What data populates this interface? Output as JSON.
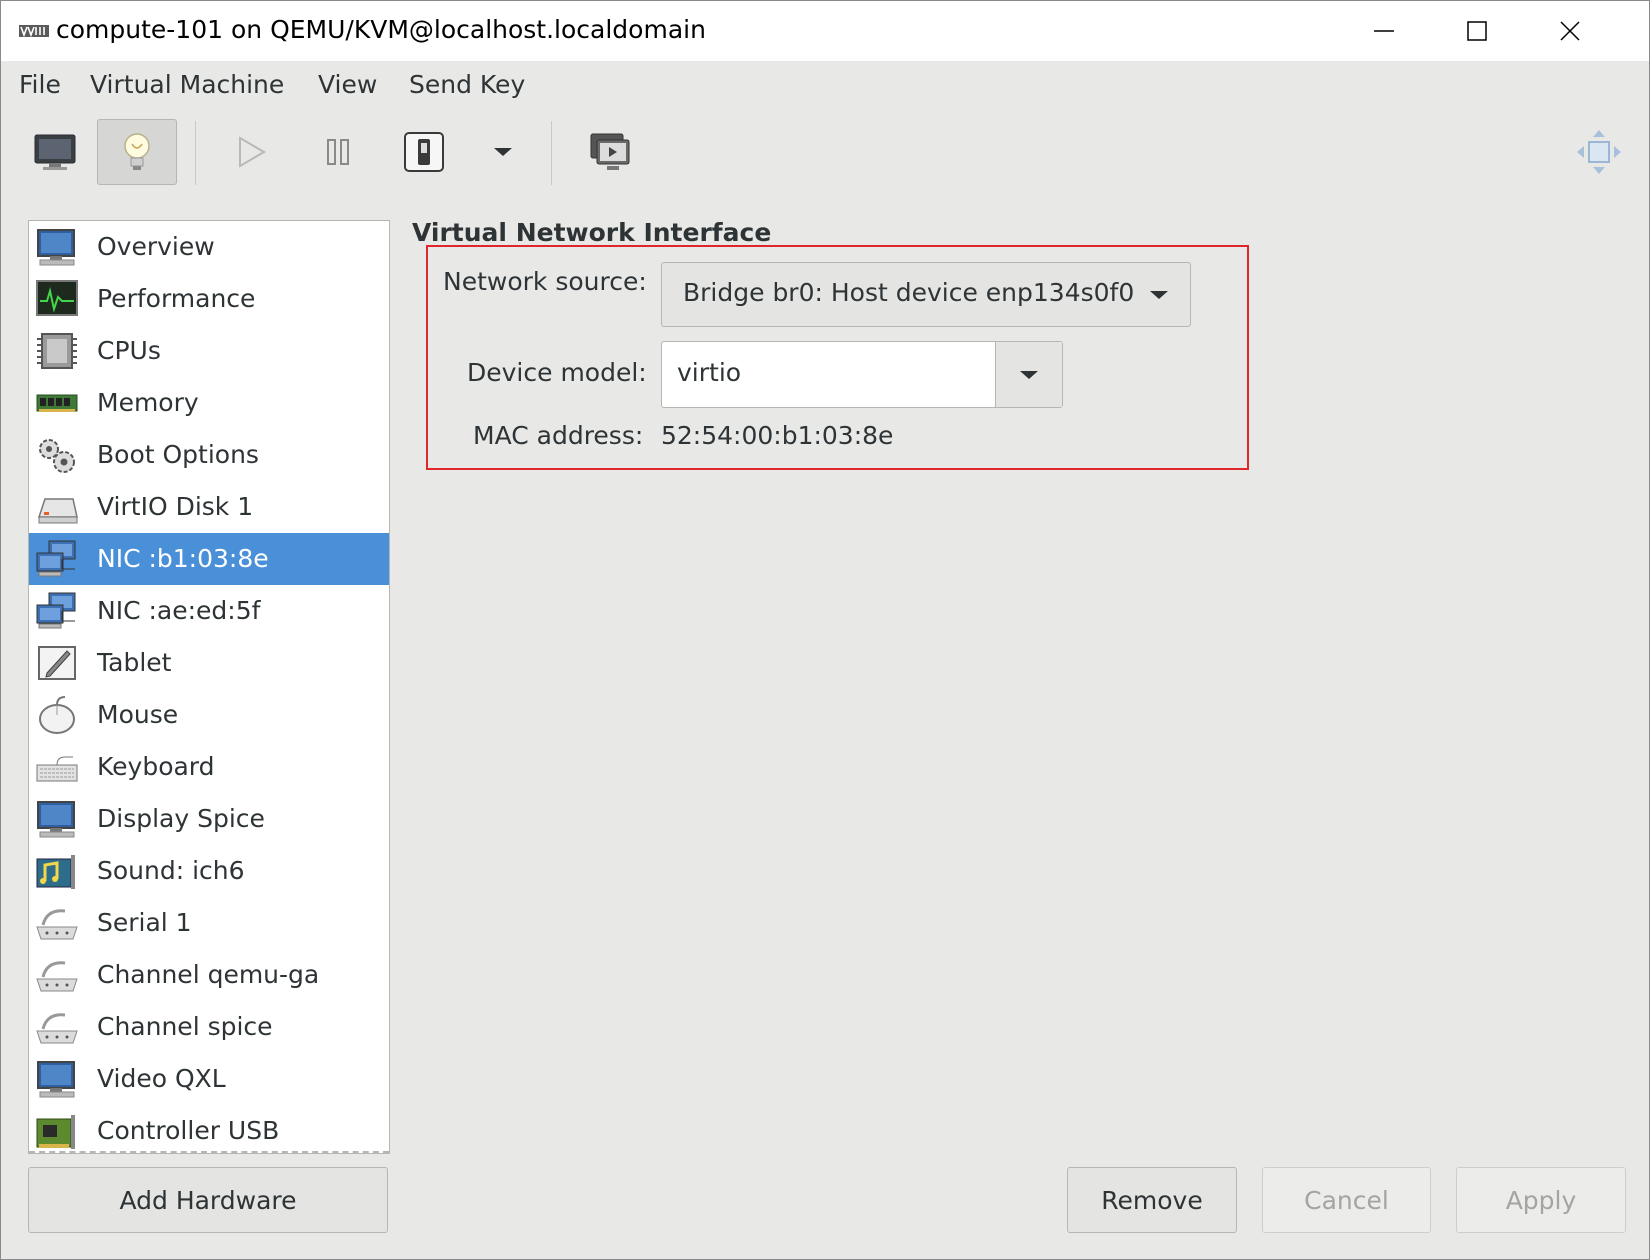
{
  "window": {
    "title": "compute-101 on QEMU/KVM@localhost.localdomain"
  },
  "menubar": {
    "items": [
      "File",
      "Virtual Machine",
      "View",
      "Send Key"
    ]
  },
  "toolbar": {
    "buttons": [
      {
        "icon": "console-monitor-icon",
        "pressed": false
      },
      {
        "icon": "lightbulb-details-icon",
        "pressed": true
      },
      {
        "icon": "play-icon",
        "pressed": false
      },
      {
        "icon": "pause-icon",
        "pressed": false
      },
      {
        "icon": "power-switch-icon",
        "pressed": false
      },
      {
        "icon": "chevron-down-icon",
        "pressed": false
      },
      {
        "icon": "snapshots-icon",
        "pressed": false
      },
      {
        "icon": "fullscreen-move-icon",
        "pressed": false
      }
    ]
  },
  "sidebar": {
    "items": [
      {
        "label": "Overview",
        "icon": "monitor-icon"
      },
      {
        "label": "Performance",
        "icon": "performance-graph-icon"
      },
      {
        "label": "CPUs",
        "icon": "cpu-chip-icon"
      },
      {
        "label": "Memory",
        "icon": "memory-module-icon"
      },
      {
        "label": "Boot Options",
        "icon": "gears-icon"
      },
      {
        "label": "VirtIO Disk 1",
        "icon": "disk-drive-icon"
      },
      {
        "label": "NIC :b1:03:8e",
        "icon": "network-nic-icon",
        "selected": true
      },
      {
        "label": "NIC :ae:ed:5f",
        "icon": "network-nic-icon"
      },
      {
        "label": "Tablet",
        "icon": "tablet-pen-icon"
      },
      {
        "label": "Mouse",
        "icon": "mouse-icon"
      },
      {
        "label": "Keyboard",
        "icon": "keyboard-icon"
      },
      {
        "label": "Display Spice",
        "icon": "monitor-icon"
      },
      {
        "label": "Sound: ich6",
        "icon": "sound-card-icon"
      },
      {
        "label": "Serial 1",
        "icon": "serial-port-icon"
      },
      {
        "label": "Channel qemu-ga",
        "icon": "serial-port-icon"
      },
      {
        "label": "Channel spice",
        "icon": "serial-port-icon"
      },
      {
        "label": "Video QXL",
        "icon": "monitor-icon"
      },
      {
        "label": "Controller USB",
        "icon": "pci-card-icon"
      }
    ],
    "add_hardware_label": "Add Hardware"
  },
  "details": {
    "section_title": "Virtual Network Interface",
    "network_source_label": "Network source:",
    "network_source_value": "Bridge br0: Host device enp134s0f0",
    "device_model_label": "Device model:",
    "device_model_value": "virtio",
    "mac_address_label": "MAC address:",
    "mac_address_value": "52:54:00:b1:03:8e"
  },
  "buttons": {
    "remove": "Remove",
    "cancel": "Cancel",
    "apply": "Apply"
  },
  "colors": {
    "selection": "#4a90d9",
    "highlight_box": "#e0262b",
    "window_bg": "#e8e8e7"
  }
}
